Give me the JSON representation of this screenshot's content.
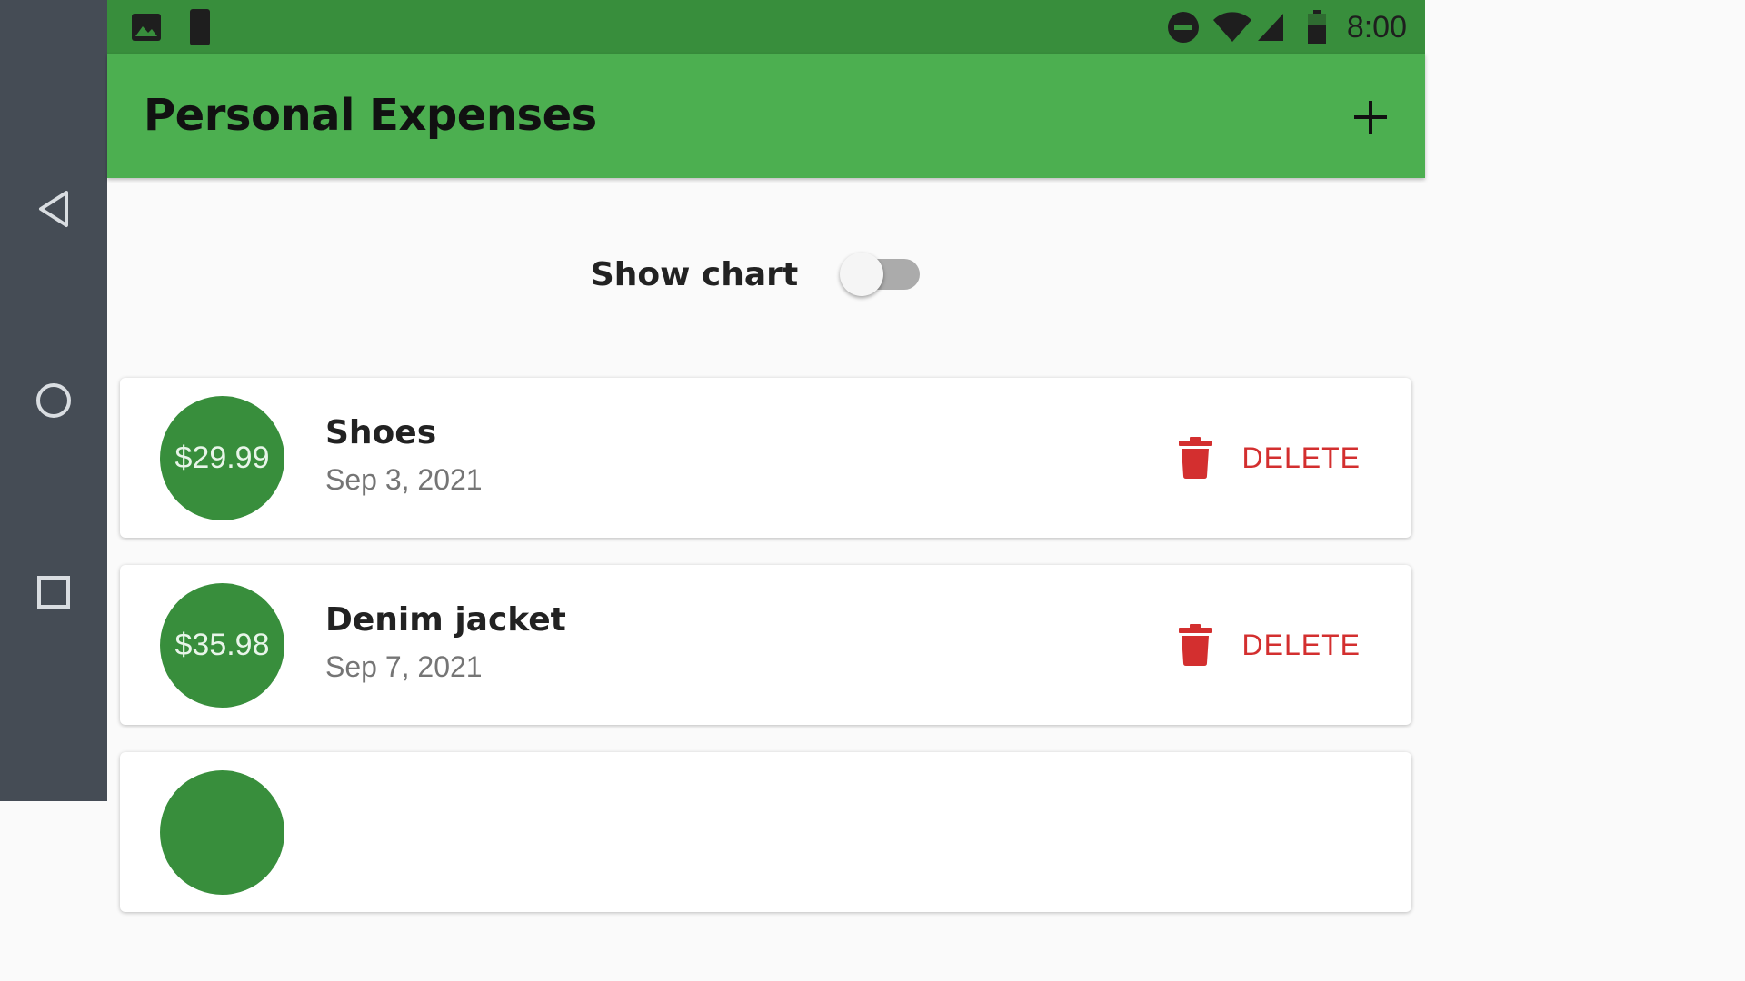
{
  "status_bar": {
    "time": "8:00",
    "left_icons": [
      "image-icon",
      "moon-phone-icon"
    ],
    "right_icons": [
      "do-not-disturb-icon",
      "wifi-icon",
      "cell-signal-icon",
      "battery-icon"
    ]
  },
  "nav_bar": {
    "buttons": [
      "back-icon",
      "home-icon",
      "recents-icon"
    ]
  },
  "app_bar": {
    "title": "Personal Expenses",
    "action_icon": "add-icon"
  },
  "chart_toggle": {
    "label": "Show chart",
    "checked": false
  },
  "expenses": [
    {
      "amount": "$29.99",
      "title": "Shoes",
      "date": "Sep 3, 2021",
      "delete_label": "DELETE"
    },
    {
      "amount": "$35.98",
      "title": "Denim jacket",
      "date": "Sep 7, 2021",
      "delete_label": "DELETE"
    }
  ],
  "colors": {
    "primary": "#4caf50",
    "primary_dark": "#388e3c",
    "danger": "#d32f2f",
    "nav_bar": "#454c55"
  }
}
